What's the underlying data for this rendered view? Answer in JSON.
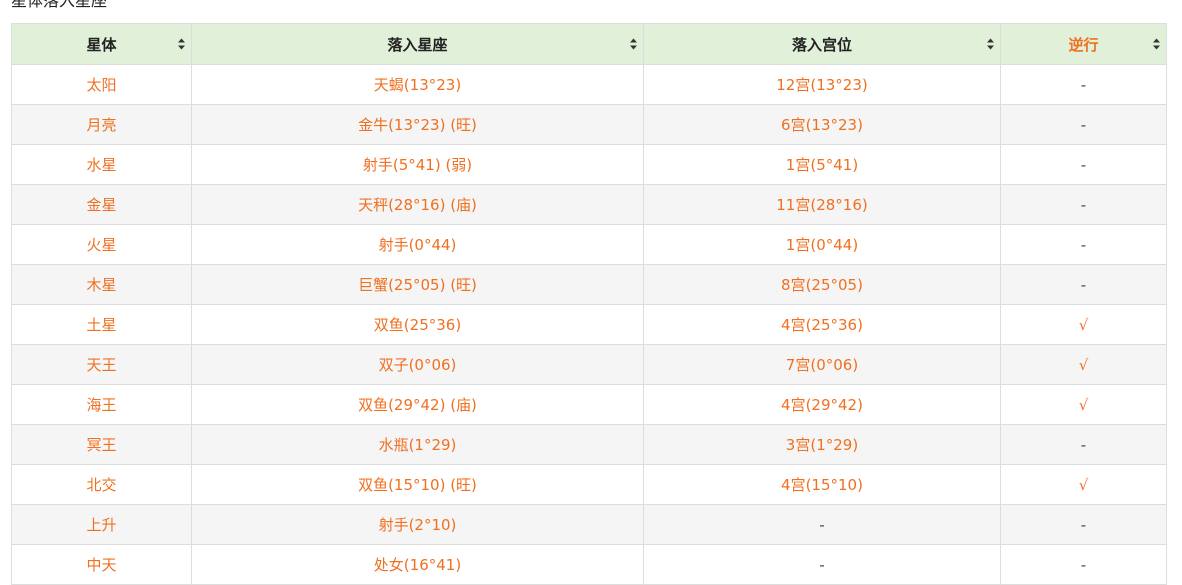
{
  "caption": "星体落入星座",
  "colors": {
    "accent": "#f07020",
    "header_bg": "#e1f0d9",
    "stripe": "#f5f5f5",
    "border": "#dddddd"
  },
  "columns": [
    {
      "label": "星体",
      "icon": "sort-icon"
    },
    {
      "label": "落入星座",
      "icon": "sort-icon"
    },
    {
      "label": "落入宫位",
      "icon": "sort-icon"
    },
    {
      "label": "逆行",
      "icon": "sort-icon"
    }
  ],
  "rows": [
    [
      "太阳",
      "天蝎(13°23)",
      "12宫(13°23)",
      "-"
    ],
    [
      "月亮",
      "金牛(13°23) (旺)",
      "6宫(13°23)",
      "-"
    ],
    [
      "水星",
      "射手(5°41) (弱)",
      "1宫(5°41)",
      "-"
    ],
    [
      "金星",
      "天秤(28°16) (庙)",
      "11宫(28°16)",
      "-"
    ],
    [
      "火星",
      "射手(0°44)",
      "1宫(0°44)",
      "-"
    ],
    [
      "木星",
      "巨蟹(25°05) (旺)",
      "8宫(25°05)",
      "-"
    ],
    [
      "土星",
      "双鱼(25°36)",
      "4宫(25°36)",
      "√"
    ],
    [
      "天王",
      "双子(0°06)",
      "7宫(0°06)",
      "√"
    ],
    [
      "海王",
      "双鱼(29°42) (庙)",
      "4宫(29°42)",
      "√"
    ],
    [
      "冥王",
      "水瓶(1°29)",
      "3宫(1°29)",
      "-"
    ],
    [
      "北交",
      "双鱼(15°10) (旺)",
      "4宫(15°10)",
      "√"
    ],
    [
      "上升",
      "射手(2°10)",
      "-",
      "-"
    ],
    [
      "中天",
      "处女(16°41)",
      "-",
      "-"
    ]
  ]
}
